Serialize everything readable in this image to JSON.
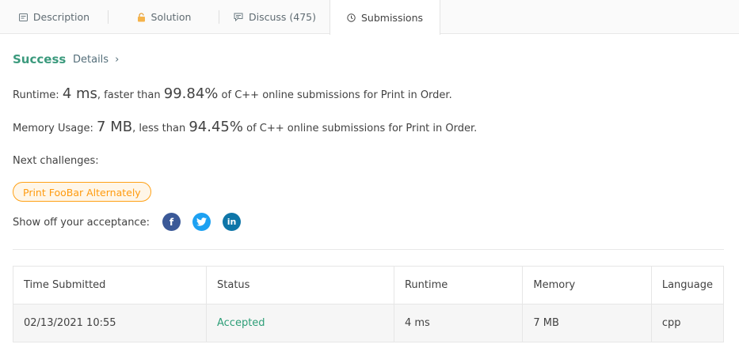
{
  "tabs": [
    {
      "label": "Description",
      "icon": "description-icon"
    },
    {
      "label": "Solution",
      "icon": "lock-icon"
    },
    {
      "label": "Discuss (475)",
      "icon": "discuss-icon"
    },
    {
      "label": "Submissions",
      "icon": "clock-icon"
    }
  ],
  "result": {
    "status": "Success",
    "details_label": "Details",
    "details_chevron": "›"
  },
  "runtime": {
    "label": "Runtime:",
    "value": "4 ms",
    "middle": ", faster than",
    "percent": "99.84%",
    "suffix": "of C++ online submissions for Print in Order."
  },
  "memory": {
    "label": "Memory Usage:",
    "value": "7 MB",
    "middle": ", less than",
    "percent": "94.45%",
    "suffix": "of C++ online submissions for Print in Order."
  },
  "next": {
    "label": "Next challenges:",
    "challenge": "Print FooBar Alternately"
  },
  "share": {
    "label": "Show off your acceptance:",
    "facebook_glyph": "f",
    "linkedin_glyph": "in"
  },
  "colors": {
    "success": "#3b9a7d",
    "accent_orange": "#ffa116",
    "accepted": "#2e9e78",
    "facebook": "#3b5998",
    "twitter": "#1da1f2",
    "linkedin": "#0e76a8"
  },
  "table": {
    "headers": [
      "Time Submitted",
      "Status",
      "Runtime",
      "Memory",
      "Language"
    ],
    "rows": [
      [
        "02/13/2021 10:55",
        "Accepted",
        "4 ms",
        "7 MB",
        "cpp"
      ]
    ]
  }
}
